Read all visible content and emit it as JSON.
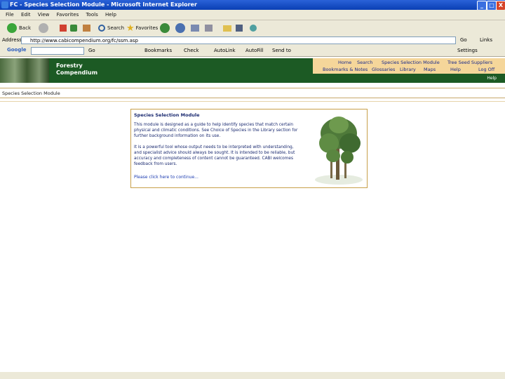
{
  "window": {
    "title": "FC - Species Selection Module - Microsoft Internet Explorer"
  },
  "window_buttons": [
    "_",
    "□",
    "X"
  ],
  "menu": [
    "File",
    "Edit",
    "View",
    "Favorites",
    "Tools",
    "Help"
  ],
  "toolbar": {
    "back": "Back",
    "search": "Search",
    "favorites": "Favorites"
  },
  "address": {
    "label": "Address",
    "url": "http://www.cabicompendium.org/fc/ssm.asp",
    "go": "Go",
    "links": "Links"
  },
  "google": {
    "brand": "Google",
    "items": [
      "Go",
      "Bookmarks",
      "Check",
      "AutoLink",
      "AutoFill",
      "Send to"
    ],
    "settings": "Settings"
  },
  "site": {
    "title_line1": "Forestry",
    "title_line2": "Compendium",
    "nav_row1": [
      "Home",
      "Search",
      "Species Selection Module",
      "Tree Seed Suppliers"
    ],
    "nav_row2": [
      "Bookmarks & Notes",
      "Glossaries",
      "Library",
      "Maps",
      "Help",
      "Log Off"
    ],
    "help": "Help"
  },
  "page": {
    "module_label": "Species Selection Module",
    "card_title": "Species Selection Module",
    "para1": "This module is designed as a guide to help identify species that match certain physical and climatic conditions. See Choice of Species in the Library section for further background information on its use.",
    "para2": "It is a powerful tool whose output needs to be interpreted with understanding, and specialist advice should always be sought. It is intended to be reliable, but accuracy and completeness of content cannot be guaranteed. CABI welcomes feedback from users.",
    "continue": "Please click here to continue..."
  }
}
